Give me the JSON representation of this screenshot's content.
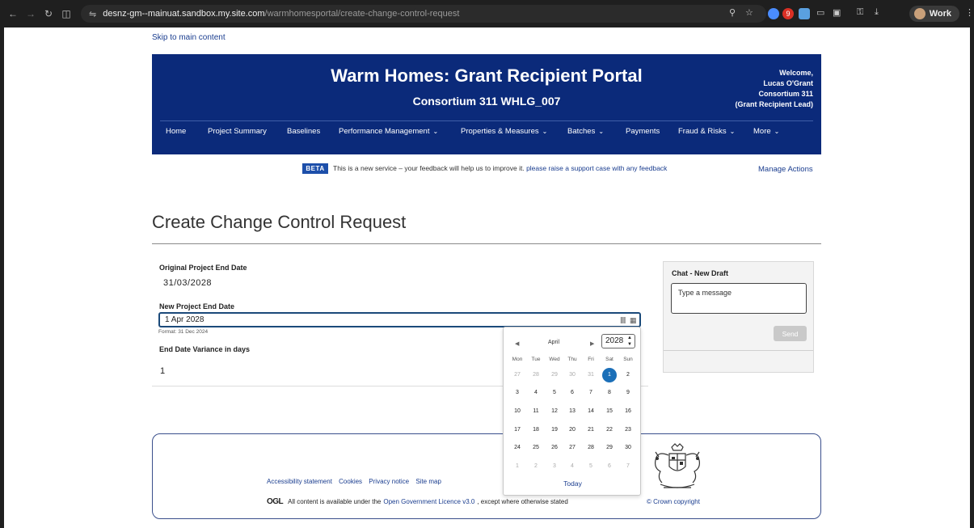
{
  "browser": {
    "url_host": "desnz-gm--mainuat.sandbox.my.site.com",
    "url_path": "/warmhomesportal/create-change-control-request",
    "profile_label": "Work",
    "extension_badge": "9"
  },
  "skip_link": "Skip to main content",
  "header": {
    "title": "Warm Homes: Grant Recipient Portal",
    "subtitle": "Consortium 311 WHLG_007",
    "welcome_line1": "Welcome,",
    "welcome_line2": "Lucas O'Grant",
    "welcome_line3": "Consortium 311",
    "welcome_line4": "(Grant Recipient Lead)",
    "menu": [
      {
        "label": "Home",
        "dropdown": false
      },
      {
        "label": "Project Summary",
        "dropdown": false
      },
      {
        "label": "Baselines",
        "dropdown": false
      },
      {
        "label": "Performance Management",
        "dropdown": true
      },
      {
        "label": "Properties & Measures",
        "dropdown": true
      },
      {
        "label": "Batches",
        "dropdown": true
      },
      {
        "label": "Payments",
        "dropdown": false
      },
      {
        "label": "Fraud & Risks",
        "dropdown": true
      },
      {
        "label": "More",
        "dropdown": true
      }
    ]
  },
  "beta": {
    "tag": "BETA",
    "text": "This is a new service – your feedback will help us to improve it.",
    "link": "please raise a support case with any feedback"
  },
  "manage_actions": "Manage Actions",
  "page_title": "Create Change Control Request",
  "form": {
    "original_label": "Original Project End Date",
    "original_value": "31/03/2028",
    "new_label": "New Project End Date",
    "new_value": "1 Apr 2028",
    "format_hint": "Format: 31 Dec 2024",
    "variance_label": "End Date Variance in days",
    "variance_value": "1"
  },
  "datepicker": {
    "month": "April",
    "year": "2028",
    "weekdays": [
      "Mon",
      "Tue",
      "Wed",
      "Thu",
      "Fri",
      "Sat",
      "Sun"
    ],
    "weeks": [
      [
        "27",
        "28",
        "29",
        "30",
        "31",
        "1",
        "2"
      ],
      [
        "3",
        "4",
        "5",
        "6",
        "7",
        "8",
        "9"
      ],
      [
        "10",
        "11",
        "12",
        "13",
        "14",
        "15",
        "16"
      ],
      [
        "17",
        "18",
        "19",
        "20",
        "21",
        "22",
        "23"
      ],
      [
        "24",
        "25",
        "26",
        "27",
        "28",
        "29",
        "30"
      ],
      [
        "1",
        "2",
        "3",
        "4",
        "5",
        "6",
        "7"
      ]
    ],
    "muted_first_week_count": 5,
    "selected_day": "1",
    "today_label": "Today"
  },
  "chat": {
    "title": "Chat - New Draft",
    "placeholder": "Type a message",
    "send_label": "Send"
  },
  "footer": {
    "links": [
      "Accessibility statement",
      "Cookies",
      "Privacy notice",
      "Site map"
    ],
    "ogl_logo": "OGL",
    "licence_prefix": "All content is available under the",
    "licence_link": "Open Government Licence v3.0",
    "licence_suffix": ", except where otherwise stated",
    "crown": "© Crown copyright"
  },
  "colors": {
    "header_bg": "#0b2a7a",
    "link": "#1a3d8f",
    "selected_day": "#1b6fb8"
  }
}
